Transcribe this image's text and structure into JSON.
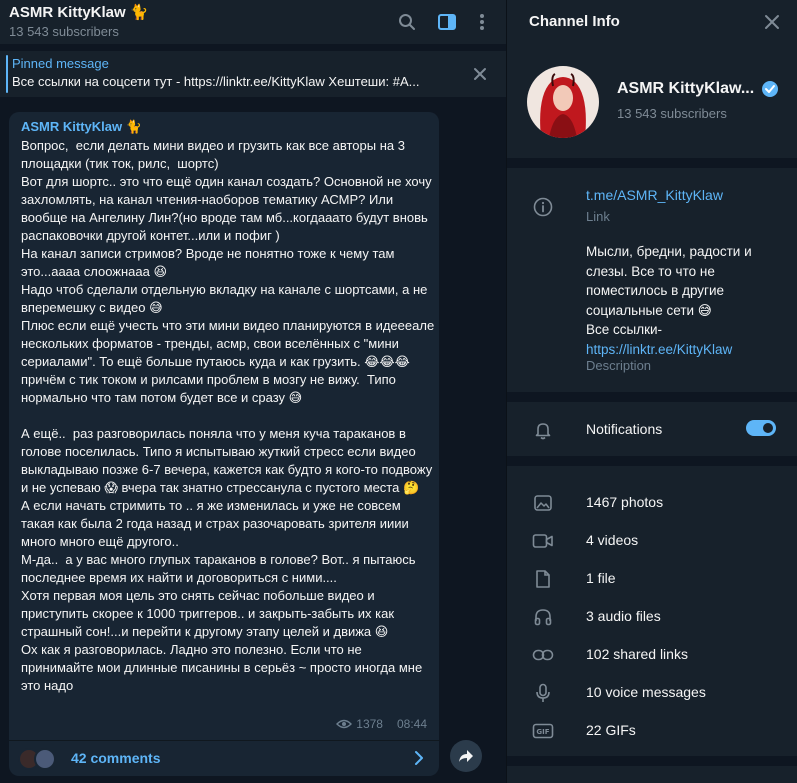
{
  "chat": {
    "title": "ASMR KittyKlaw 🐈",
    "subscribers": "13 543 subscribers"
  },
  "pinned": {
    "title": "Pinned message",
    "text": "Все ссылки на соцсети тут - https://linktr.ee/KittyKlaw  Хештеши: #A..."
  },
  "message": {
    "author": "ASMR KittyKlaw 🐈",
    "text": "Вопрос,  если делать мини видео и грузить как все авторы на 3 площадки (тик ток, рилс,  шортс)\nВот для шортс.. это что ещё один канал создать? Основной не хочу захломлять, на канал чтения-наоборов тематику АСМР? Или вообще на Ангелину Лин?(но вроде там мб...когдааато будут вновь распаковочки другой контет...или и пофиг )\nНа канал записи стримов? Вроде не понятно тоже к чему там это...аааа слоожнааа 😆\nНадо чтоб сделали отдельную вкладку на канале с шортсами, а не вперемешку с видео 😅\nПлюс если ещё учесть что эти мини видео планируются в идеееале нескольких форматов - тренды, асмр, свои вселённых с \"мини сериалами\". То ещё больше путаюсь куда и как грузить. 😂😂😂 причём с тик током и рилсами проблем в мозгу не вижу.  Типо нормально что там потом будет все и сразу 😅\n\nА ещё..  раз разговорилась поняла что у меня куча тараканов в голове поселилась. Типо я испытываю жуткий стресс если видео выкладываю позже 6-7 вечера, кажется как будто я кого-то подвожу и не успеваю 😱 вчера так знатно стрессанула с пустого места 🤔\nА если начать стримить то .. я же изменилась и уже не совсем такая как была 2 года назад и страх разочаровать зрителя ииии много много ещё другого..\nМ-да..  а у вас много глупых тараканов в голове? Вот.. я пытаюсь последнее время их найти и договориться с ними....\nХотя первая моя цель это снять сейчас побольше видео и приступить скорее к 1000 триггеров.. и закрыть-забыть их как страшный сон!...и перейти к другому этапу целей и движа 😆\nОх как я разговорилась. Ладно это полезно. Если что не принимайте мои длинные писанины в серьёз ~ просто иногда мне это надо",
    "views": "1378",
    "time": "08:44",
    "comments_label": "42 comments"
  },
  "info": {
    "title": "Channel Info",
    "name": "ASMR KittyKlaw...",
    "subscribers": "13 543 subscribers",
    "link": "t.me/ASMR_KittyKlaw",
    "link_label": "Link",
    "description": "Мысли, бредни, радости и слезы. Все то что не поместилось в другие социальные сети 😅\nВсе ссылки-",
    "description_link": "https://linktr.ee/KittyKlaw",
    "description_label": "Description",
    "notifications_label": "Notifications",
    "notifications_on": true,
    "media": [
      {
        "icon": "photo-icon",
        "label": "1467 photos"
      },
      {
        "icon": "video-icon",
        "label": "4 videos"
      },
      {
        "icon": "file-icon",
        "label": "1 file"
      },
      {
        "icon": "headphones-icon",
        "label": "3 audio files"
      },
      {
        "icon": "link-icon",
        "label": "102 shared links"
      },
      {
        "icon": "microphone-icon",
        "label": "10 voice messages"
      },
      {
        "icon": "gif-icon",
        "label": "22 GIFs"
      }
    ]
  },
  "colors": {
    "accent": "#5eb5f7",
    "panel_bg": "#17212b",
    "app_bg": "#0e1621",
    "bubble_bg": "#182533"
  }
}
